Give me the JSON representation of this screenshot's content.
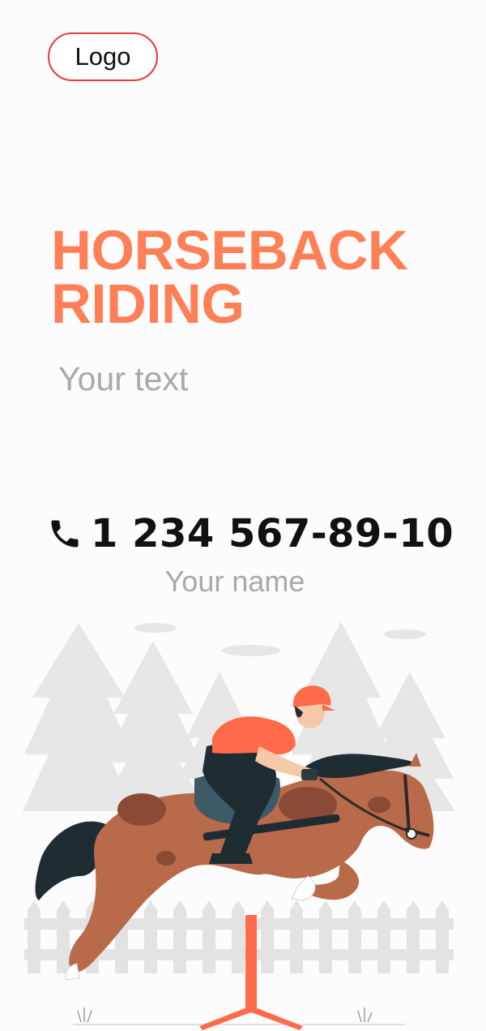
{
  "logo": {
    "label": "Logo"
  },
  "headline": {
    "line1": "HORSEBACK",
    "line2": "RIDING"
  },
  "subtext": "Your text",
  "contact": {
    "icon": "phone-icon",
    "phone": "1 234 567-89-10",
    "name": "Your name"
  },
  "illustration": {
    "icon": "horse-rider-illustration"
  },
  "colors": {
    "accent": "#ff7f56",
    "logo_border": "#e83a3a",
    "muted_text": "#a9a9a9"
  }
}
